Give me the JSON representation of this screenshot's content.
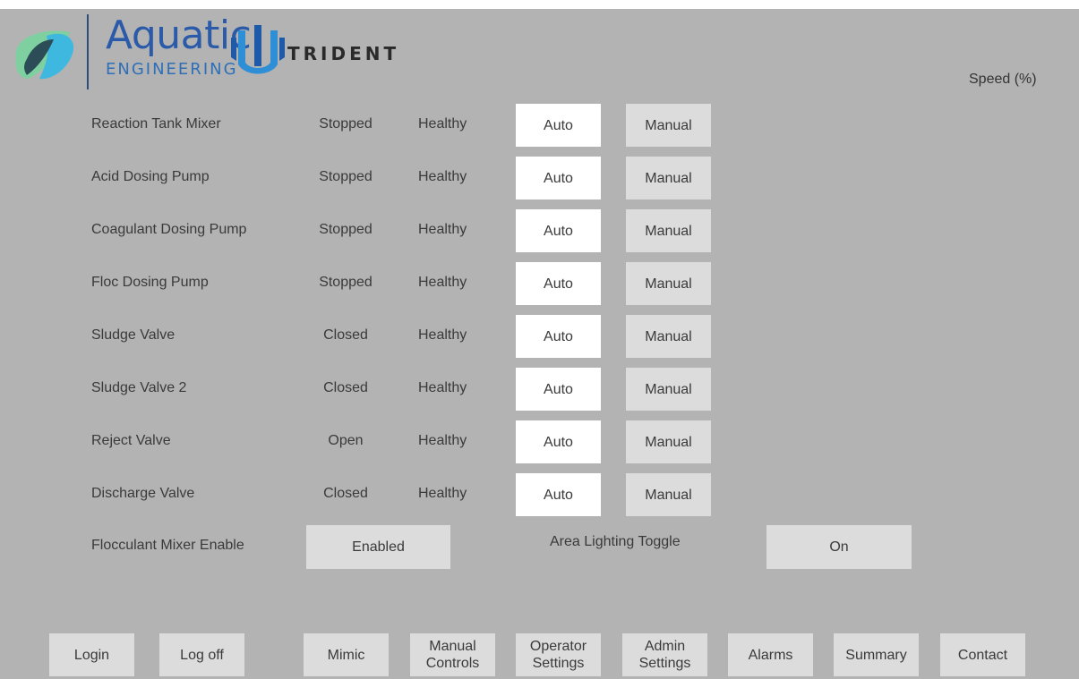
{
  "brand": {
    "name": "Aquatic",
    "subtitle": "ENGINEERING",
    "partner": "TRIDENT",
    "colors": {
      "accent_blue": "#2b5aa8",
      "leaf_green": "#7fd0a0",
      "leaf_dark": "#2c4d57",
      "leaf_cyan": "#3fb8e0"
    }
  },
  "speed_header": "Speed (%)",
  "devices": [
    {
      "name": "Reaction Tank Mixer",
      "state": "Stopped",
      "health": "Healthy",
      "auto_label": "Auto",
      "manual_label": "Manual"
    },
    {
      "name": "Acid Dosing Pump",
      "state": "Stopped",
      "health": "Healthy",
      "auto_label": "Auto",
      "manual_label": "Manual"
    },
    {
      "name": "Coagulant Dosing Pump",
      "state": "Stopped",
      "health": "Healthy",
      "auto_label": "Auto",
      "manual_label": "Manual"
    },
    {
      "name": "Floc Dosing Pump",
      "state": "Stopped",
      "health": "Healthy",
      "auto_label": "Auto",
      "manual_label": "Manual"
    },
    {
      "name": "Sludge Valve",
      "state": "Closed",
      "health": "Healthy",
      "auto_label": "Auto",
      "manual_label": "Manual"
    },
    {
      "name": "Sludge Valve 2",
      "state": "Closed",
      "health": "Healthy",
      "auto_label": "Auto",
      "manual_label": "Manual"
    },
    {
      "name": "Reject Valve",
      "state": "Open",
      "health": "Healthy",
      "auto_label": "Auto",
      "manual_label": "Manual"
    },
    {
      "name": "Discharge Valve",
      "state": "Closed",
      "health": "Healthy",
      "auto_label": "Auto",
      "manual_label": "Manual"
    }
  ],
  "toggles": {
    "flocculant_label": "Flocculant Mixer Enable",
    "flocculant_value": "Enabled",
    "lighting_label": "Area Lighting Toggle",
    "lighting_value": "On"
  },
  "nav": {
    "login": "Login",
    "logoff": "Log off",
    "mimic": "Mimic",
    "manual_controls": "Manual Controls",
    "operator_settings": "Operator Settings",
    "admin_settings": "Admin Settings",
    "alarms": "Alarms",
    "summary": "Summary",
    "contact": "Contact"
  }
}
